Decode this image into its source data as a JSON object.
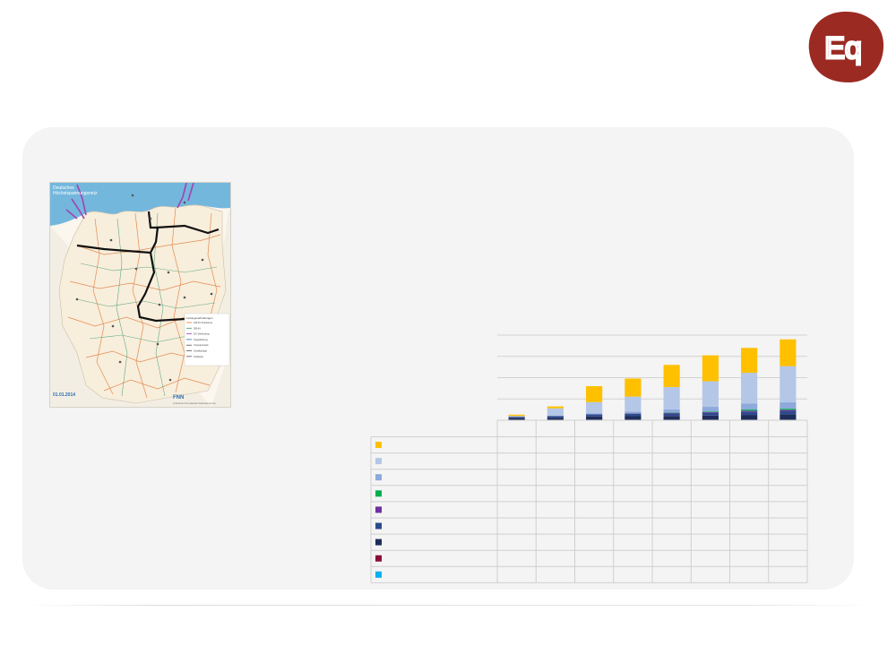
{
  "logo": {
    "letters": "Eq",
    "color": "#9b2a23"
  },
  "map": {
    "title_line1": "Deutsches",
    "title_line2": "Höchstspannungsnetz",
    "date": "01.01.2014",
    "publisher": "FNN",
    "publisher_sub": "FORUM NETZTECHNIK/NETZBETRIEB IM VDE",
    "legend_title": "Leitungsverbindungen",
    "legend_items": [
      "220 kV Freileitung",
      "380 kV",
      "DC-Verbindung",
      "Kuppelleitung",
      "Umspannwerk",
      "Schaltanlage",
      "Kraftwerk"
    ],
    "city_labels": [
      "Hamburg",
      "Bremen",
      "Berlin",
      "Hannover",
      "Magdeburg",
      "Leipzig",
      "Dresden",
      "Erfurt",
      "Köln",
      "Frankfurt",
      "Nürnberg",
      "Stuttgart",
      "München",
      "Rostock",
      "Kiel"
    ]
  },
  "chart_data": {
    "type": "bar",
    "stacked": true,
    "categories": [
      "",
      "",
      "",
      "",
      "",
      "",
      "",
      ""
    ],
    "ylim": [
      0,
      40
    ],
    "gridlines": [
      0,
      10,
      20,
      30,
      40
    ],
    "series": [
      {
        "color": "#00b0f0",
        "values": [
          0,
          0,
          0,
          0,
          0,
          0,
          0,
          0
        ]
      },
      {
        "color": "#8b0d3a",
        "values": [
          0,
          0,
          0,
          0,
          0,
          0,
          0,
          0
        ]
      },
      {
        "color": "#1f2d5a",
        "values": [
          1.0,
          1.2,
          1.8,
          1.9,
          2.0,
          2.2,
          2.5,
          2.7
        ]
      },
      {
        "color": "#2e4a8c",
        "values": [
          0.6,
          0.7,
          1.0,
          1.1,
          1.2,
          1.3,
          1.4,
          1.5
        ]
      },
      {
        "color": "#7030a0",
        "values": [
          0,
          0,
          0,
          0.2,
          0.3,
          0.3,
          0.5,
          0.6
        ]
      },
      {
        "color": "#00b050",
        "values": [
          0,
          0,
          0,
          0.1,
          0.2,
          0.3,
          0.6,
          0.6
        ]
      },
      {
        "color": "#8ea9db",
        "values": [
          0.1,
          0.2,
          0.4,
          0.8,
          1.4,
          2.2,
          2.8,
          3.0
        ]
      },
      {
        "color": "#b4c7e7",
        "values": [
          0.3,
          3.5,
          5.3,
          7.0,
          10.5,
          12.0,
          14.5,
          17.0
        ]
      },
      {
        "color": "#ffc000",
        "values": [
          0.6,
          0.9,
          7.5,
          8.5,
          10.4,
          12.2,
          11.7,
          12.6
        ]
      }
    ],
    "table_order": [
      8,
      7,
      6,
      5,
      4,
      3,
      2,
      1,
      0
    ]
  }
}
